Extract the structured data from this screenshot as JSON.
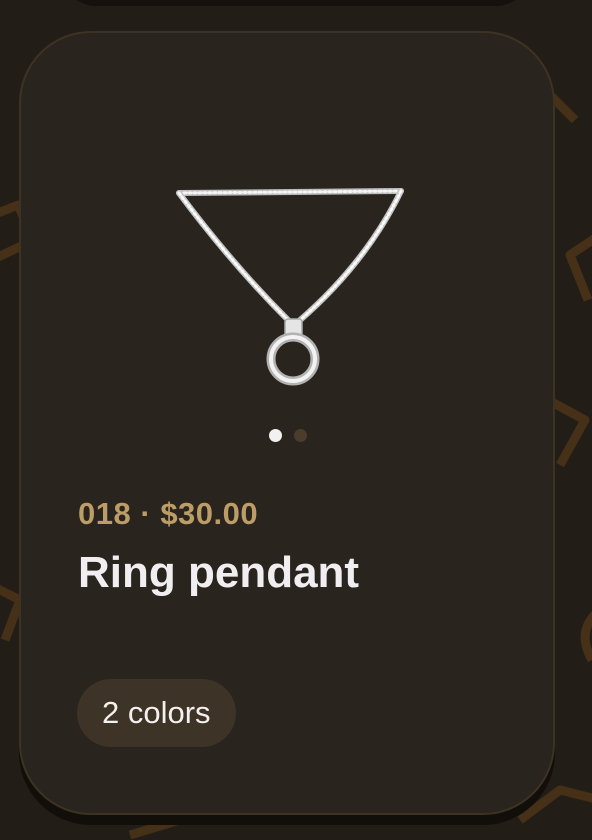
{
  "product": {
    "code": "018",
    "separator": "·",
    "price": "$30.00",
    "title": "Ring pendant",
    "colors_label": "2 colors"
  },
  "carousel": {
    "total": 2,
    "active_index": 0
  },
  "theme": {
    "background": "#231d17",
    "card": "#2a241e",
    "accent": "#bc9d67",
    "text": "#f1eef2",
    "pill": "#3d3327"
  },
  "icons": {
    "product_image": "silver-chain-ring-pendant"
  }
}
